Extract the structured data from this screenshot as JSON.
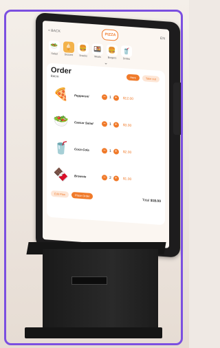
{
  "topbar": {
    "back_label": "< BACK",
    "logo_text": "PIZZA",
    "lang_label": "EN"
  },
  "categories": [
    {
      "label": "Salad",
      "icon": "salad-bowl-icon",
      "glyph": "🥗"
    },
    {
      "label": "Dessert",
      "icon": "ice-cream-icon",
      "glyph": "🍦"
    },
    {
      "label": "Snacks",
      "icon": "snack-icon",
      "glyph": "🍔"
    },
    {
      "label": "Meals",
      "icon": "meal-icon",
      "glyph": "🍱"
    },
    {
      "label": "Burgers",
      "icon": "burger-icon",
      "glyph": "🍔"
    },
    {
      "label": "Drinks",
      "icon": "drink-icon",
      "glyph": "🥤"
    }
  ],
  "order": {
    "title": "Order",
    "mode": "Eat in",
    "toggle_on": "Here",
    "toggle_off": "Take out",
    "items": [
      {
        "name": "Pepperoni",
        "qty": "1",
        "price": "$12.00",
        "glyph": "🍕"
      },
      {
        "name": "Caesar Salad",
        "qty": "1",
        "price": "$3.00",
        "glyph": "🥗"
      },
      {
        "name": "Coca-Cola",
        "qty": "1",
        "price": "$2.00",
        "glyph": "🥤"
      },
      {
        "name": "Brownie",
        "qty": "2",
        "price": "$1.00",
        "glyph": "🍫"
      }
    ],
    "edit_label": "Edit Plan",
    "place_label": "Place Order",
    "total_label": "Total",
    "total_value": "$18.00"
  },
  "colors": {
    "accent": "#f07a2a",
    "frame": "#7b4fe0",
    "kiosk": "#1d1c1d"
  }
}
